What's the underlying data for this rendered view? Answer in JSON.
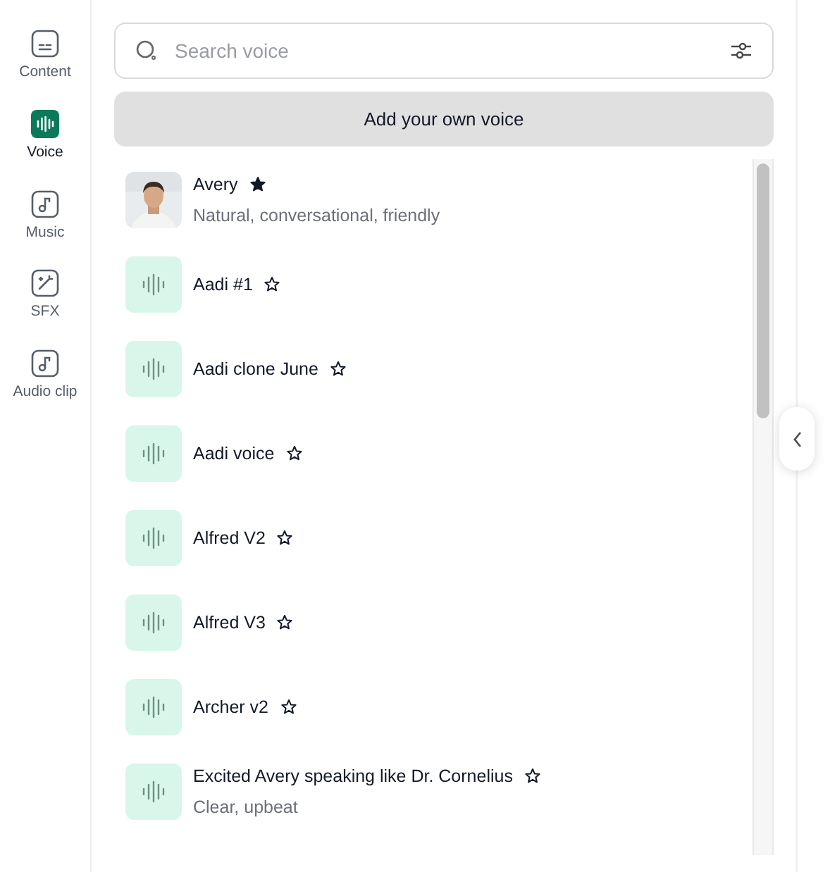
{
  "sidebar": {
    "items": [
      {
        "label": "Content",
        "kind": "captions",
        "selected": false
      },
      {
        "label": "Voice",
        "kind": "voice",
        "selected": true
      },
      {
        "label": "Music",
        "kind": "note",
        "selected": false
      },
      {
        "label": "SFX",
        "kind": "wand",
        "selected": false
      },
      {
        "label": "Audio clip",
        "kind": "note",
        "selected": false
      }
    ]
  },
  "search": {
    "placeholder": "Search voice"
  },
  "add_button": "Add your own voice",
  "voices": [
    {
      "name": "Avery",
      "description": "Natural, conversational, friendly",
      "favorite": true,
      "kind": "picture"
    },
    {
      "name": "Aadi #1",
      "favorite": false,
      "kind": "waveform"
    },
    {
      "name": "Aadi clone June",
      "favorite": false,
      "kind": "waveform"
    },
    {
      "name": "Aadi voice",
      "favorite": false,
      "kind": "waveform"
    },
    {
      "name": "Alfred V2",
      "favorite": false,
      "kind": "waveform"
    },
    {
      "name": "Alfred V3",
      "favorite": false,
      "kind": "waveform"
    },
    {
      "name": "Archer v2",
      "favorite": false,
      "kind": "waveform"
    },
    {
      "name": "Excited Avery speaking like Dr. Cornelius",
      "description": "Clear, upbeat",
      "favorite": false,
      "kind": "waveform"
    }
  ]
}
